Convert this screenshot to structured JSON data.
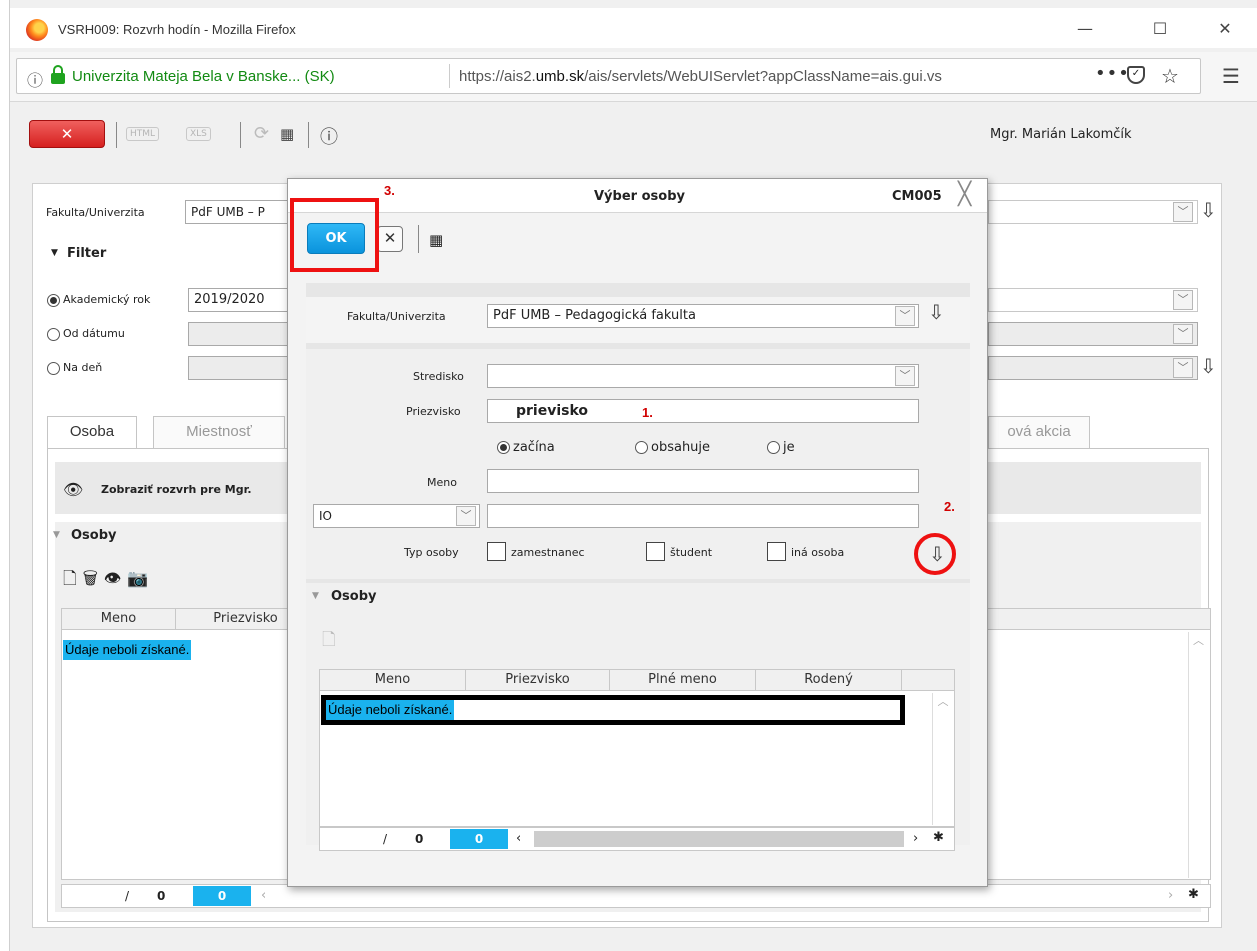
{
  "window": {
    "title": "VSRH009: Rozvrh hodín - Mozilla Firefox",
    "minimize": "—",
    "maximize": "☐",
    "close": "✕"
  },
  "urlbar": {
    "site_identity": "Univerzita Mateja Bela v Banske... (SK)",
    "url_prefix": "https://ais2.",
    "url_domain": "umb.sk",
    "url_rest": "/ais/servlets/WebUIServlet?appClassName=ais.gui.vs",
    "more": "•••"
  },
  "toolbar": {
    "close_label": "✕",
    "html_label": "HTML",
    "xls_label": "XLS",
    "info": "ⓘ",
    "user": "Mgr. Marián Lakomčík"
  },
  "main": {
    "fakulta_label": "Fakulta/Univerzita",
    "fakulta_value": "PdF UMB – P",
    "filter_title": "Filter",
    "radio_rok": "Akademický rok",
    "rok_value": "2019/2020",
    "radio_od": "Od dátumu",
    "radio_na": "Na deň",
    "tabs": [
      {
        "label": "Osoba"
      },
      {
        "label": "Miestnosť"
      },
      {
        "label": "ová akcia"
      }
    ],
    "zobrazit": "Zobraziť rozvrh pre Mgr.",
    "osoby_title": "Osoby",
    "grid_headers": [
      "Meno",
      "Priezvisko"
    ],
    "no_data": "Údaje neboli získané.",
    "pager_slash": "/",
    "pager_count": "0",
    "pager_current": "0"
  },
  "dialog": {
    "title": "Výber osoby",
    "code": "CM005",
    "ok_label": "OK",
    "cancel_label": "✕",
    "fakulta_label": "Fakulta/Univerzita",
    "fakulta_value": "PdF UMB – Pedagogická fakulta",
    "stredisko_label": "Stredisko",
    "stredisko_value": "",
    "priezvisko_label": "Priezvisko",
    "priezvisko_value": "prievisko",
    "match_options": [
      "začína",
      "obsahuje",
      "je"
    ],
    "meno_label": "Meno",
    "meno_value": "",
    "id_type_value": "IO",
    "id_value": "",
    "typ_osoby_label": "Typ osoby",
    "typ_options": [
      "zamestnanec",
      "študent",
      "iná osoba"
    ],
    "osoby_title": "Osoby",
    "grid_headers": [
      "Meno",
      "Priezvisko",
      "Plné meno",
      "Rodený"
    ],
    "no_data": "Údaje neboli získané.",
    "pager_slash": "/",
    "pager_count": "0",
    "pager_current": "0"
  },
  "annotations": {
    "step1": "1.",
    "step2": "2.",
    "step3": "3.",
    "color": "#e11111"
  }
}
